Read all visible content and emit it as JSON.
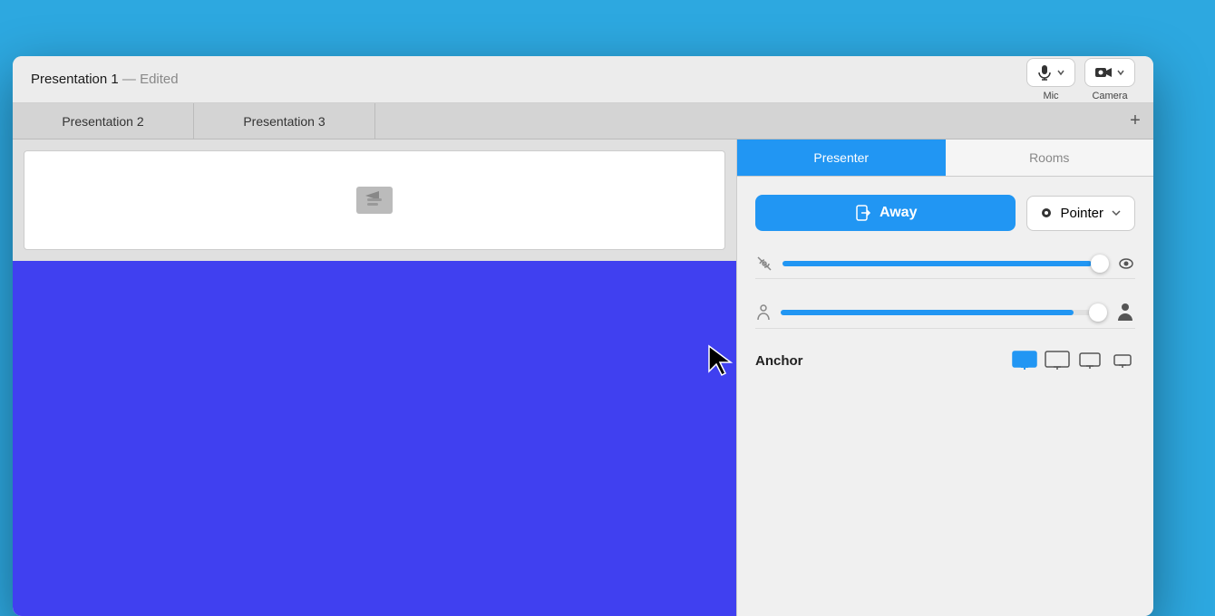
{
  "window": {
    "title": "Presentation 1",
    "title_separator": "—",
    "title_edited": "Edited"
  },
  "toolbar": {
    "mic_label": "Mic",
    "camera_label": "Camera"
  },
  "tabs": [
    {
      "id": "presentation2",
      "label": "Presentation 2"
    },
    {
      "id": "presentation3",
      "label": "Presentation 3"
    }
  ],
  "tab_add_label": "+",
  "panel": {
    "tab_presenter": "Presenter",
    "tab_rooms": "Rooms",
    "away_button_label": "Away",
    "pointer_label": "Pointer",
    "anchor_label": "Anchor",
    "slider_visibility_value": 95,
    "slider_size_value": 90
  },
  "anchor_icons": [
    "screen-fill-icon",
    "screen-icon",
    "screen-small-icon",
    "screen-minimal-icon"
  ],
  "colors": {
    "blue": "#2196f3",
    "slide_blue": "#4040f0",
    "background": "#2da8e0"
  }
}
